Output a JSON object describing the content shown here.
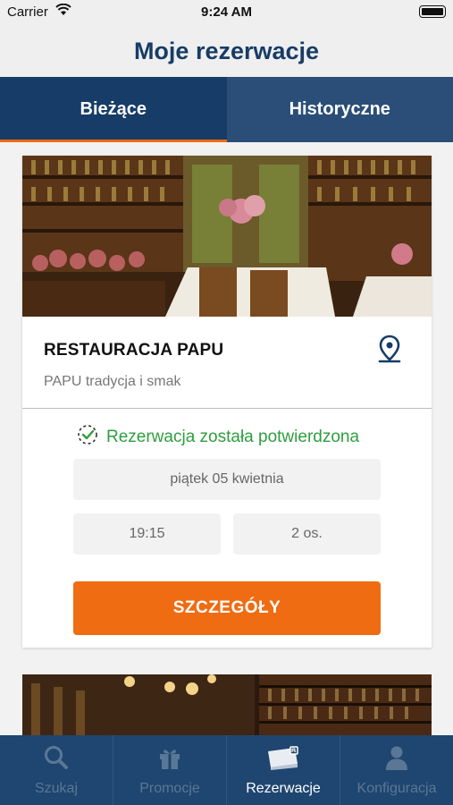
{
  "status_bar": {
    "carrier": "Carrier",
    "time": "9:24 AM"
  },
  "header": {
    "title": "Moje rezerwacje"
  },
  "tabs": [
    {
      "label": "Bieżące",
      "active": true
    },
    {
      "label": "Historyczne",
      "active": false
    }
  ],
  "reservation": {
    "name": "RESTAURACJA PAPU",
    "subtitle": "PAPU tradycja i smak",
    "status": "Rezerwacja została potwierdzona",
    "date": "piątek 05 kwietnia",
    "time": "19:15",
    "guests": "2 os.",
    "details_button": "SZCZEGÓŁY"
  },
  "tab_bar": [
    {
      "label": "Szukaj",
      "icon": "search-icon",
      "active": false
    },
    {
      "label": "Promocje",
      "icon": "gift-icon",
      "active": false
    },
    {
      "label": "Rezerwacje",
      "icon": "ticket-icon",
      "active": true
    },
    {
      "label": "Konfiguracja",
      "icon": "user-icon",
      "active": false
    }
  ],
  "colors": {
    "primary": "#173c67",
    "accent": "#ef6c13",
    "success": "#2e9e3f"
  }
}
